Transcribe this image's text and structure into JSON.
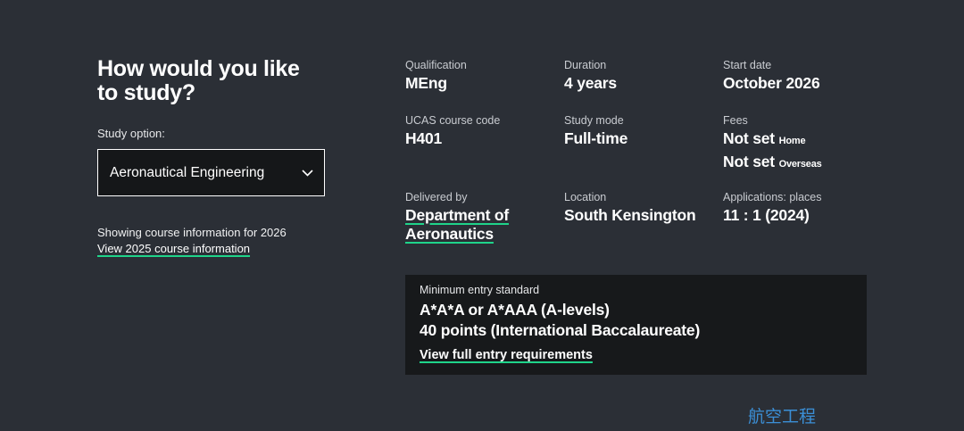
{
  "study": {
    "heading": "How would you like to study?",
    "option_label": "Study option:",
    "selected_option": "Aeronautical Engineering",
    "showing_text": "Showing course information for 2026",
    "view_previous_link": "View 2025 course information"
  },
  "details": {
    "qualification": {
      "label": "Qualification",
      "value": "MEng"
    },
    "duration": {
      "label": "Duration",
      "value": "4 years"
    },
    "start_date": {
      "label": "Start date",
      "value": "October 2026"
    },
    "ucas_code": {
      "label": "UCAS course code",
      "value": "H401"
    },
    "study_mode": {
      "label": "Study mode",
      "value": "Full-time"
    },
    "fees": {
      "label": "Fees",
      "home_value": "Not set",
      "home_suffix": "Home",
      "overseas_value": "Not set",
      "overseas_suffix": "Overseas"
    },
    "delivered_by": {
      "label": "Delivered by",
      "value": "Department of Aeronautics"
    },
    "location": {
      "label": "Location",
      "value": "South Kensington"
    },
    "applications": {
      "label": "Applications: places",
      "value": "11 : 1 (2024)"
    }
  },
  "entry": {
    "title": "Minimum entry standard",
    "line1": "A*A*A or A*AAA (A-levels)",
    "line2": "40 points (International Baccalaureate)",
    "link": "View full entry requirements"
  },
  "caption": "航空工程",
  "colors": {
    "background": "#2b2f36",
    "box_background": "#17191b",
    "link_underline": "#1fd48a",
    "caption": "#3b8fd6"
  },
  "icons": {
    "select_chevron": "chevron-down-icon"
  }
}
